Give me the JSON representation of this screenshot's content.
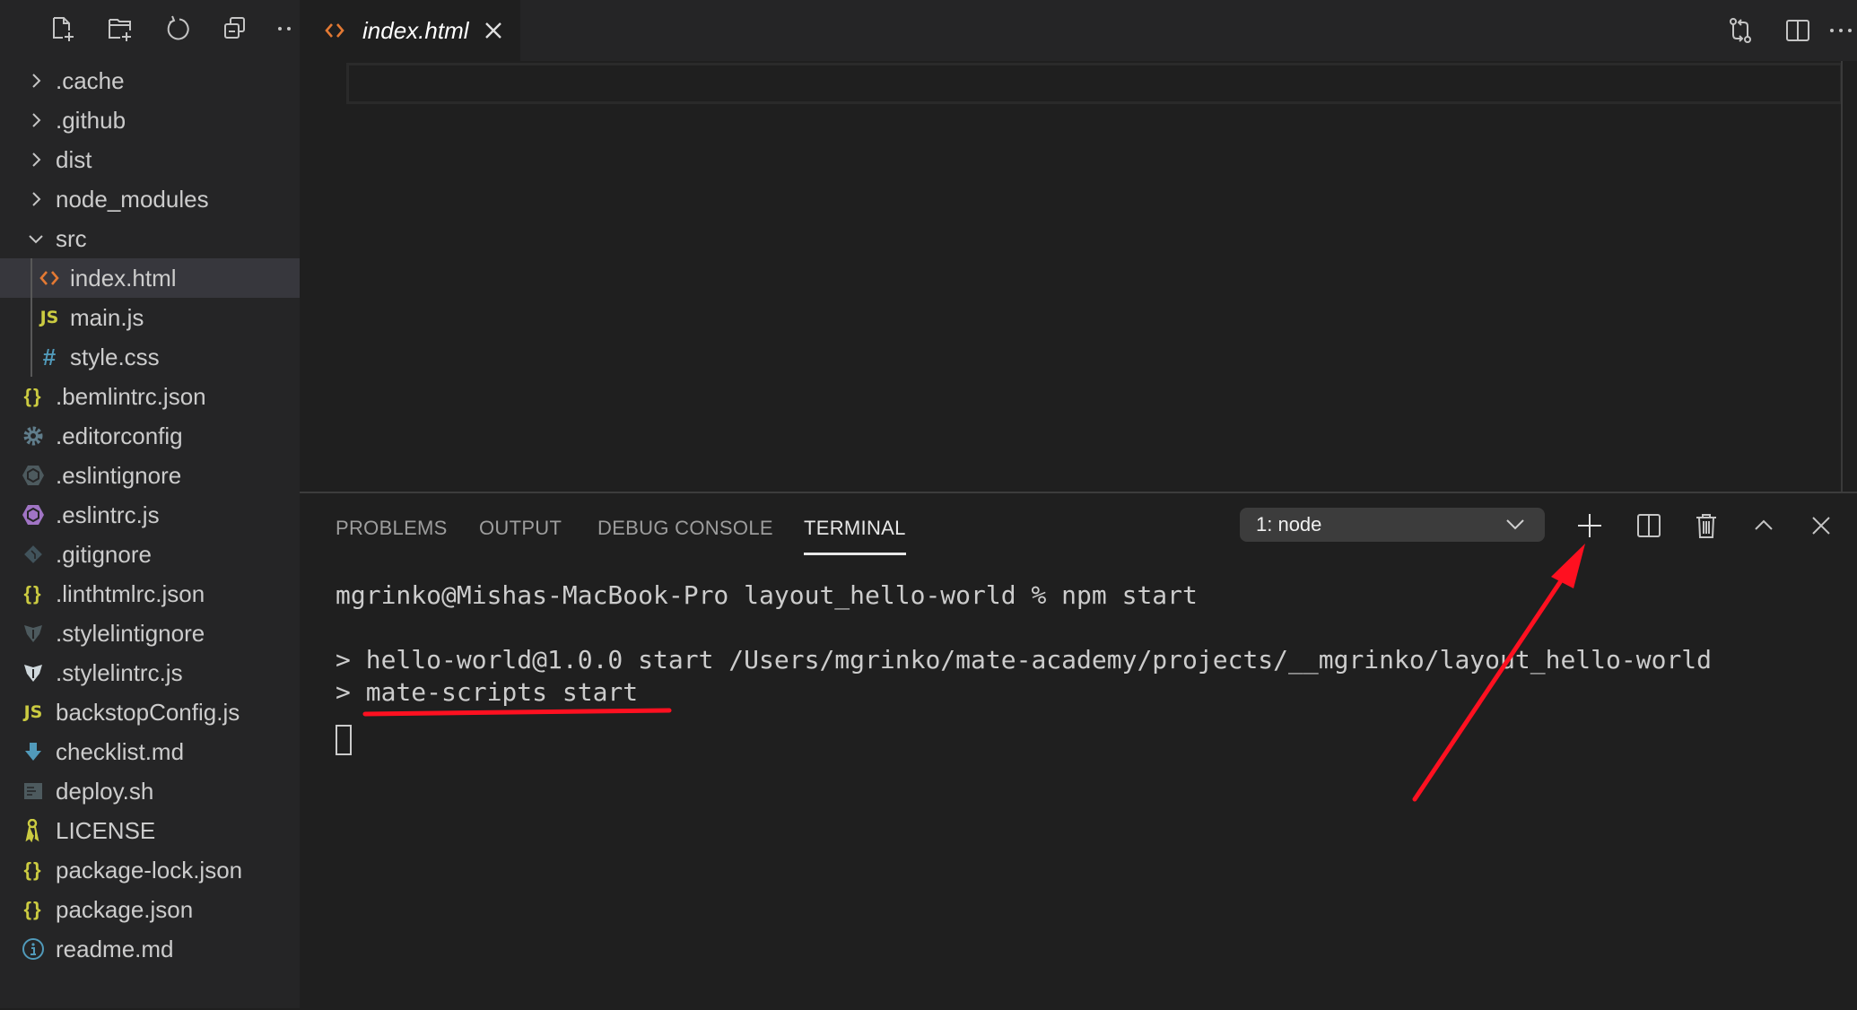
{
  "sidebar": {
    "toolbar": [
      {
        "name": "new-file-icon",
        "tooltip": "New File"
      },
      {
        "name": "new-folder-icon",
        "tooltip": "New Folder"
      },
      {
        "name": "refresh-icon",
        "tooltip": "Refresh Explorer"
      },
      {
        "name": "collapse-all-icon",
        "tooltip": "Collapse Folders"
      },
      {
        "name": "more-icon",
        "tooltip": "More Actions"
      }
    ],
    "items": [
      {
        "label": ".cache",
        "type": "folder",
        "expanded": false,
        "level": 0
      },
      {
        "label": ".github",
        "type": "folder",
        "expanded": false,
        "level": 0
      },
      {
        "label": "dist",
        "type": "folder",
        "expanded": false,
        "level": 0
      },
      {
        "label": "node_modules",
        "type": "folder",
        "expanded": false,
        "level": 0
      },
      {
        "label": "src",
        "type": "folder",
        "expanded": true,
        "level": 0
      },
      {
        "label": "index.html",
        "type": "file",
        "icon": "html-icon",
        "level": 1,
        "selected": true
      },
      {
        "label": "main.js",
        "type": "file",
        "icon": "js-icon",
        "level": 1
      },
      {
        "label": "style.css",
        "type": "file",
        "icon": "css-icon",
        "level": 1
      },
      {
        "label": ".bemlintrc.json",
        "type": "file",
        "icon": "json-icon",
        "level": 0
      },
      {
        "label": ".editorconfig",
        "type": "file",
        "icon": "gear-icon",
        "level": 0
      },
      {
        "label": ".eslintignore",
        "type": "file",
        "icon": "eslint-ignore-icon",
        "level": 0
      },
      {
        "label": ".eslintrc.js",
        "type": "file",
        "icon": "eslint-icon",
        "level": 0
      },
      {
        "label": ".gitignore",
        "type": "file",
        "icon": "git-icon",
        "level": 0
      },
      {
        "label": ".linthtmlrc.json",
        "type": "file",
        "icon": "json-icon",
        "level": 0
      },
      {
        "label": ".stylelintignore",
        "type": "file",
        "icon": "stylelint-ignore-icon",
        "level": 0
      },
      {
        "label": ".stylelintrc.js",
        "type": "file",
        "icon": "stylelint-icon",
        "level": 0
      },
      {
        "label": "backstopConfig.js",
        "type": "file",
        "icon": "js-icon",
        "level": 0
      },
      {
        "label": "checklist.md",
        "type": "file",
        "icon": "markdown-arrow-icon",
        "level": 0
      },
      {
        "label": "deploy.sh",
        "type": "file",
        "icon": "shell-icon",
        "level": 0
      },
      {
        "label": "LICENSE",
        "type": "file",
        "icon": "license-key-icon",
        "level": 0
      },
      {
        "label": "package-lock.json",
        "type": "file",
        "icon": "json-icon",
        "level": 0
      },
      {
        "label": "package.json",
        "type": "file",
        "icon": "json-icon",
        "level": 0
      },
      {
        "label": "readme.md",
        "type": "file",
        "icon": "info-icon",
        "level": 0
      }
    ]
  },
  "editor": {
    "tab": {
      "label": "index.html",
      "icon": "html-icon",
      "italic": true
    },
    "actions": [
      "compare-changes-icon",
      "split-editor-icon",
      "more-actions-icon"
    ]
  },
  "panel": {
    "tabs": [
      {
        "label": "PROBLEMS",
        "active": false
      },
      {
        "label": "OUTPUT",
        "active": false
      },
      {
        "label": "DEBUG CONSOLE",
        "active": false
      },
      {
        "label": "TERMINAL",
        "active": true
      }
    ],
    "terminal_select": {
      "value": "1: node"
    },
    "actions": [
      "new-terminal-icon",
      "split-terminal-icon",
      "kill-terminal-icon",
      "maximize-panel-icon",
      "close-panel-icon"
    ],
    "terminal_lines": [
      "mgrinko@Mishas-MacBook-Pro layout_hello-world % npm start",
      "",
      "> hello-world@1.0.0 start /Users/mgrinko/mate-academy/projects/__mgrinko/layout_hello-world",
      "> mate-scripts start"
    ]
  },
  "annotations": {
    "color": "#ff1020",
    "underline_target": "mate-scripts start",
    "arrow_target": "new-terminal-button"
  },
  "colors": {
    "html": "#e37933",
    "js": "#cbcb41",
    "css": "#519aba",
    "json": "#cbcb41",
    "eslint": "#a074c4",
    "muted_icon": "#4d5a5e",
    "info": "#519aba"
  }
}
